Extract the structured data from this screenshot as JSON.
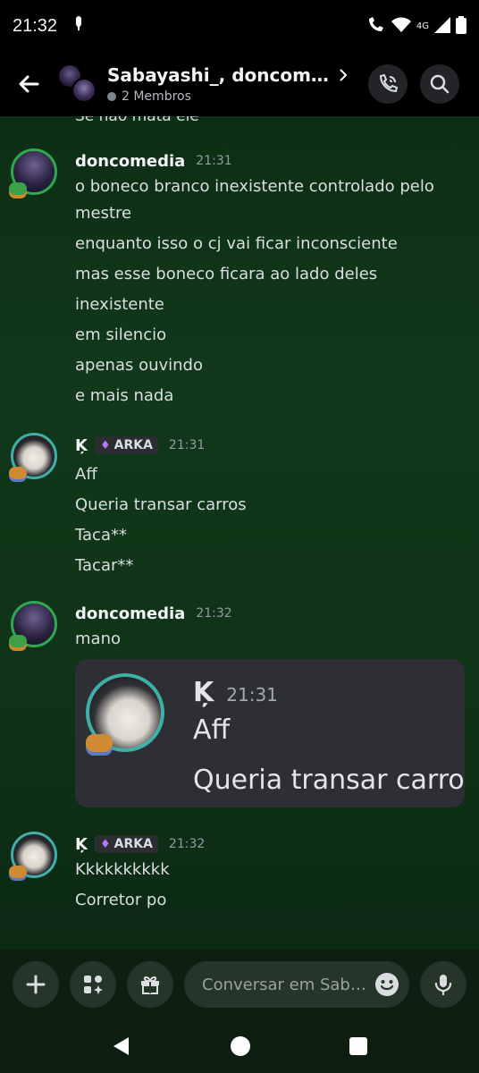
{
  "status_bar": {
    "time": "21:32",
    "network": "4G"
  },
  "header": {
    "title": "Sabayashi_, doncome…",
    "subtitle": "2 Membros"
  },
  "messages": {
    "cut_text": "Se não mata ele",
    "m1": {
      "author": "doncomedia",
      "time": "21:31",
      "lines": [
        "o boneco branco inexistente controlado pelo",
        "mestre",
        "enquanto isso o cj vai ficar inconsciente",
        "mas esse boneco ficara ao lado deles",
        "inexistente",
        "em silencio",
        "apenas ouvindo",
        "e mais nada"
      ]
    },
    "m2": {
      "author": "Ķ",
      "tag": "ARKA",
      "time": "21:31",
      "lines": [
        "Aff",
        "Queria transar carros",
        "Taca**",
        "Tacar**"
      ]
    },
    "m3": {
      "author": "doncomedia",
      "time": "21:32",
      "lines": [
        "mano"
      ],
      "embed": {
        "author": "Ķ",
        "time": "21:31",
        "lines": [
          "Aff",
          "Queria transar carros"
        ]
      }
    },
    "m4": {
      "author": "Ķ",
      "tag": "ARKA",
      "time": "21:32",
      "lines": [
        "Kkkkkkkkkk",
        "Corretor po"
      ]
    }
  },
  "composer": {
    "placeholder": "Conversar em Sab…"
  },
  "icons": {
    "back": "arrow-left-icon",
    "call": "phone-call-icon",
    "search": "search-icon",
    "plus": "plus-icon",
    "apps": "apps-icon",
    "gift": "gift-icon",
    "emoji": "emoji-icon",
    "mic": "microphone-icon"
  },
  "colors": {
    "accent_green": "#2fa84f",
    "text": "#dbdee1",
    "muted": "#949ba4",
    "header_bg": "#000000"
  }
}
